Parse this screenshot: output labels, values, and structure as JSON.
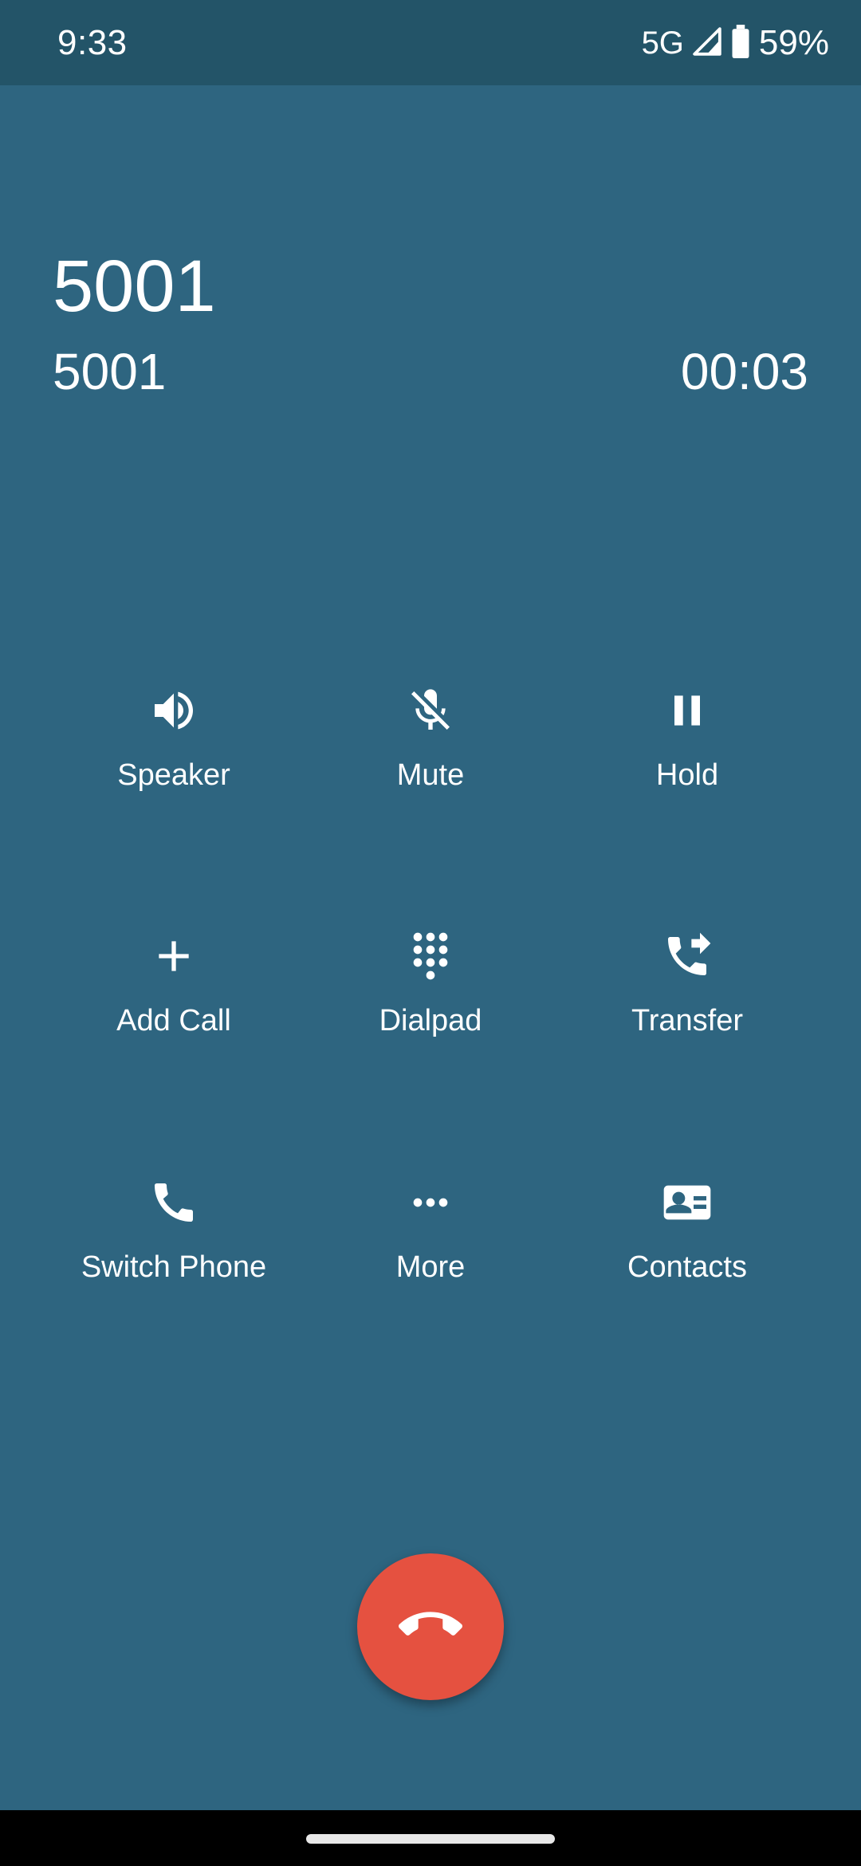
{
  "status_bar": {
    "time": "9:33",
    "network": "5G",
    "battery_percent": "59%",
    "icons": [
      "signal-icon",
      "battery-icon"
    ]
  },
  "call": {
    "name": "5001",
    "number": "5001",
    "duration": "00:03"
  },
  "actions": [
    {
      "label": "Speaker",
      "icon": "speaker-icon"
    },
    {
      "label": "Mute",
      "icon": "mic-off-icon"
    },
    {
      "label": "Hold",
      "icon": "pause-icon"
    },
    {
      "label": "Add Call",
      "icon": "plus-icon"
    },
    {
      "label": "Dialpad",
      "icon": "dialpad-icon"
    },
    {
      "label": "Transfer",
      "icon": "phone-forward-icon"
    },
    {
      "label": "Switch Phone",
      "icon": "phone-icon"
    },
    {
      "label": "More",
      "icon": "more-horiz-icon"
    },
    {
      "label": "Contacts",
      "icon": "contact-card-icon"
    }
  ],
  "end_call": {
    "icon": "call-end-icon"
  },
  "colors": {
    "background": "#2e6580",
    "status_bar": "#235468",
    "end_call": "#e55140",
    "text": "#ffffff"
  }
}
